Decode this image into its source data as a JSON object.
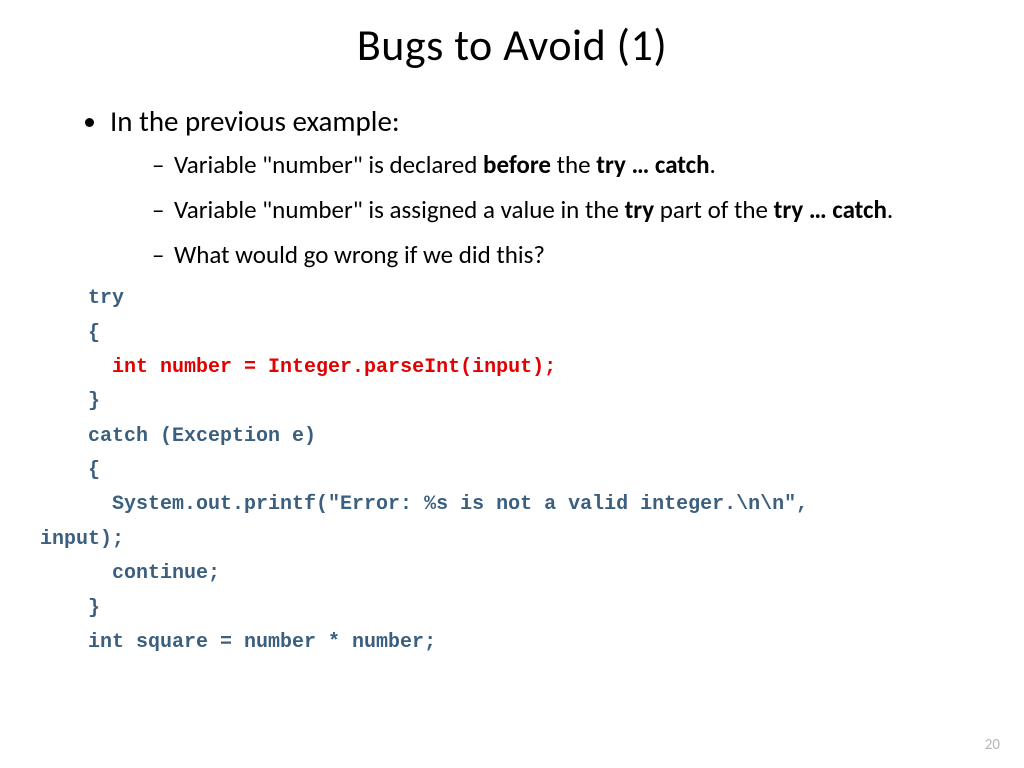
{
  "title": "Bugs to Avoid (1)",
  "bullet1": "In the previous example:",
  "sub1_a": "Variable \"number\" is declared ",
  "sub1_b": "before",
  "sub1_c": " the ",
  "sub1_d": "try … catch",
  "sub1_e": ".",
  "sub2_a": "Variable \"number\" is assigned a value in the ",
  "sub2_b": "try",
  "sub2_c": " part of the ",
  "sub2_d": "try … catch",
  "sub2_e": ".",
  "sub3": "What would go wrong if we did this?",
  "code_l1": "    try",
  "code_l2": "    {",
  "code_l3pad": "      ",
  "code_l3": "int number = Integer.parseInt(input);",
  "code_l4": "    }",
  "code_l5": "    catch (Exception e)",
  "code_l6": "    {",
  "code_l7": "      System.out.printf(\"Error: %s is not a valid integer.\\n\\n\",",
  "code_l7b": "input);",
  "code_l8": "      continue;",
  "code_l9": "    }",
  "code_l10": "    int square = number * number;",
  "pagenum": "20"
}
